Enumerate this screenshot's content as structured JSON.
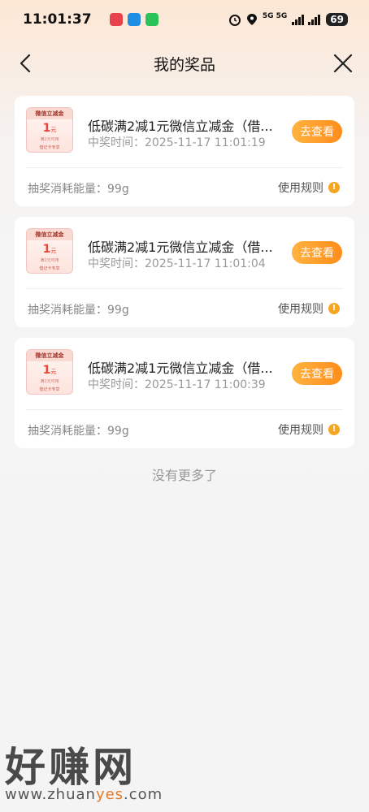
{
  "status_bar": {
    "time": "11:01:37",
    "network": "5G 5G",
    "battery": "69"
  },
  "nav": {
    "title": "我的奖品",
    "back_icon": "chevron-left-icon",
    "close_icon": "close-icon"
  },
  "prizes": [
    {
      "coupon_header": "微信立减金",
      "coupon_amount": "1",
      "coupon_unit": "元",
      "coupon_condition": "满2元可用",
      "coupon_tag": "借记卡专享",
      "title": "低碳满2减1元微信立减金（借...",
      "time": "中奖时间：2025-11-17 11:01:19",
      "button": "去查看",
      "cost": "抽奖消耗能量：99g",
      "rules": "使用规则"
    },
    {
      "coupon_header": "微信立减金",
      "coupon_amount": "1",
      "coupon_unit": "元",
      "coupon_condition": "满2元可用",
      "coupon_tag": "借记卡专享",
      "title": "低碳满2减1元微信立减金（借...",
      "time": "中奖时间：2025-11-17 11:01:04",
      "button": "去查看",
      "cost": "抽奖消耗能量：99g",
      "rules": "使用规则"
    },
    {
      "coupon_header": "微信立减金",
      "coupon_amount": "1",
      "coupon_unit": "元",
      "coupon_condition": "满2元可用",
      "coupon_tag": "借记卡专享",
      "title": "低碳满2减1元微信立减金（借...",
      "time": "中奖时间：2025-11-17 11:00:39",
      "button": "去查看",
      "cost": "抽奖消耗能量：99g",
      "rules": "使用规则"
    }
  ],
  "footer": {
    "no_more": "没有更多了"
  },
  "watermark": {
    "brand": "好赚网",
    "url_prefix": "www.zhuan",
    "url_accent": "yes",
    "url_suffix": ".com"
  },
  "colors": {
    "accent": "#ff8c1a",
    "info": "#f5a623"
  }
}
